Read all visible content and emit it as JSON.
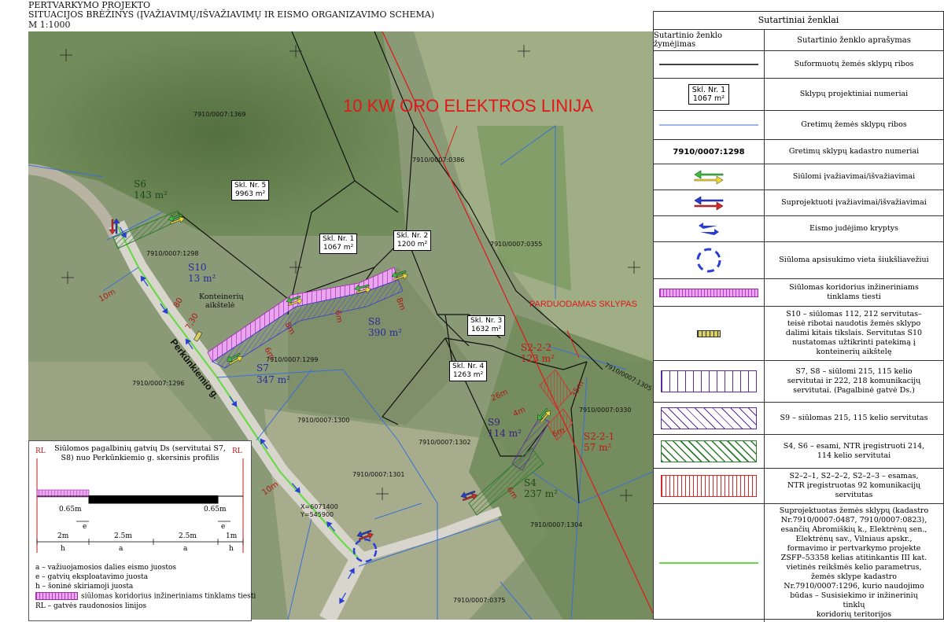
{
  "header": {
    "line1": "PERTVARKYMO PROJEKTO",
    "line2": "SITUACIJOS BRĖŽINYS (ĮVAŽIAVIMŲ/IŠVAŽIAVIMŲ IR EISMO ORGANIZAVIMO SCHEMA)",
    "line3": "M 1:1000"
  },
  "map": {
    "power_line_label": "10 KW ORO ELEKTROS LINIJA",
    "for_sale_label": "PARDUODAMAS SKLYPAS",
    "street_label": "Perkūnkiemio g.",
    "container_label": "Konteinerių\naikštelė",
    "coords": {
      "x": "X=6071400",
      "y": "Y=545900"
    },
    "cadastre_numbers": {
      "p1369": "7910/0007:1369",
      "p0386": "7910/0007:0386",
      "p0355": "7910/0007:0355",
      "p1298": "7910/0007:1298",
      "p1299": "7910/0007:1299",
      "p1296": "7910/0007:1296",
      "p1300": "7910/0007:1300",
      "p1302": "7910/0007:1302",
      "p1301": "7910/0007:1301",
      "p1304": "7910/0007:1304",
      "p0330": "7910/0007:0330",
      "p1305": "7910/0007:1305",
      "p0375": "7910/0007:0375"
    },
    "plots": {
      "s1": {
        "name": "Skl. Nr. 1",
        "area": "1067 m²"
      },
      "s2": {
        "name": "Skl. Nr. 2",
        "area": "1200 m²"
      },
      "s3": {
        "name": "Skl. Nr. 3",
        "area": "1632 m²"
      },
      "s4": {
        "name": "Skl. Nr. 4",
        "area": "1263 m²"
      },
      "s5": {
        "name": "Skl. Nr. 5",
        "area": "9963 m²"
      }
    },
    "servitudes": {
      "S6": {
        "name": "S6",
        "area": "143 m²"
      },
      "S10": {
        "name": "S10",
        "area": "13 m²"
      },
      "S7": {
        "name": "S7",
        "area": "347 m²"
      },
      "S8": {
        "name": "S8",
        "area": "390 m²"
      },
      "S9": {
        "name": "S9",
        "area": "114 m²"
      },
      "S4": {
        "name": "S4",
        "area": "237 m²"
      },
      "S222": {
        "name": "S2-2-2",
        "area": "123 m²"
      },
      "S221": {
        "name": "S2-2-1",
        "area": "57 m²"
      }
    },
    "dimensions": {
      "d10a": "10m",
      "d80": "80",
      "d730": "7,30",
      "d6a": "6m",
      "d8a": "8m",
      "d6b": "6m",
      "d8b": "8m",
      "d26": "26m",
      "d4": "4m",
      "d6c": "6m",
      "d35": "35m",
      "d6d": "6m",
      "d10b": "10m"
    },
    "colors": {
      "proposed_arrow": "#3cbf3c",
      "projected_arrow_red": "#d62a2a",
      "projected_arrow_blue": "#2a3ed6",
      "power_line": "#e01818",
      "adjacent_boundary": "#3a6fd8",
      "road_route": "#6ad84a",
      "utility_corridor": "#c84ad8"
    }
  },
  "legend": {
    "title": "Sutartiniai ženklai",
    "col1": "Sutartinio ženklo žymėjimas",
    "col2": "Sutartinio ženklo aprašymas",
    "rows": [
      {
        "desc": "Suformuotų žemės sklypų ribos"
      },
      {
        "sym1": "Skl. Nr. 1",
        "sym2": "1067 m²",
        "desc": "Sklypų projektiniai numeriai"
      },
      {
        "desc": "Gretimų žemės sklypų ribos"
      },
      {
        "sym1": "7910/0007:1298",
        "desc": "Gretimų sklypų kadastro numeriai"
      },
      {
        "desc": "Siūlomi įvažiavimai/išvažiavimai"
      },
      {
        "desc": "Suprojektuoti įvažiavimai/išvažiavimai"
      },
      {
        "desc": "Eismo judėjimo kryptys"
      },
      {
        "desc": "Siūloma apsisukimo vieta šiukšliavežiui"
      },
      {
        "desc": "Siūlomas koridorius inžineriniams\ntinklams tiesti"
      },
      {
        "desc": "S10 – siūlomas 112, 212 servitutas–\nteisė ribotai naudotis žemės sklypo\ndalimi kitais tikslais. Servitutas S10\nnustatomas užtikrinti patekimą į\nkonteinerių aikštelę"
      },
      {
        "desc": "S7, S8 – siūlomi 215, 115 kelio\nservitutai ir 222, 218 komunikacijų\nservitutai. (Pagalbinė gatvė Ds.)"
      },
      {
        "desc": "S9 – siūlomas 215, 115 kelio servitutas"
      },
      {
        "desc": "S4, S6 – esami, NTR įregistruoti  214,\n114 kelio servitutai"
      },
      {
        "desc": "S2–2–1, S2–2–2, S2–2–3 – esamas,\nNTR įregistruotas 92 komunikacijų\nservitutas"
      },
      {
        "desc": "Suprojektuotas žemės sklypų (kadastro\nNr.7910/0007:0487, 7910/0007:0823),\nesančių Abromiškių k., Elektrėnų sen.,\nElektrėnų sav., Vilniaus apskr.,\nformavimo ir pertvarkymo projekte\nZSFP–53358 kelias atitinkantis III kat.\nvietinės reikšmės kelio parametrus,\nžemės sklype kadastro\nNr.7910/0007:1296, kurio naudojimo\nbūdas – Susisiekimo ir inžinerinių\ntinklų\nkoridorių teritorijos"
      }
    ]
  },
  "profile": {
    "title": "Siūlomos pagalbinių gatvių Ds (servitutai S7,\nS8) nuo Perkūnkiemio g. skersinis profilis",
    "rl_left": "RL",
    "rl_right": "RL",
    "dims_top": [
      "0.65m",
      "0.65m"
    ],
    "e_labels": [
      "e",
      "e"
    ],
    "dims": [
      "2m",
      "2.5m",
      "2.5m",
      "1m"
    ],
    "letters": [
      "h",
      "a",
      "a",
      "h"
    ],
    "legend_lines": [
      "a – važiuojamosios dalies eismo juostos",
      "e – gatvių eksploatavimo juosta",
      "h – šoninė skiriamoji juosta",
      "siūlomas koridorius inžineriniams tinklams tiesti",
      "RL – gatvės raudonosios linijos"
    ]
  }
}
